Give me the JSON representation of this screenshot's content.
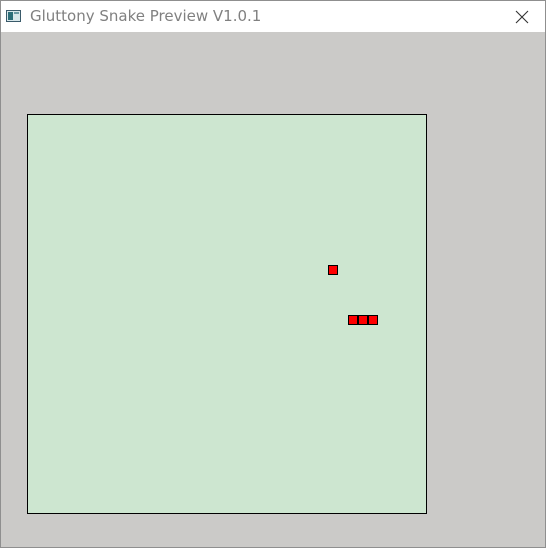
{
  "window": {
    "title": "Gluttony Snake Preview V1.0.1",
    "icon": "app-window-icon",
    "close_icon": "close-icon"
  },
  "colors": {
    "board_background": "#cde6d0",
    "board_border": "#000000",
    "snake": "#ff0000",
    "food": "#ff0000",
    "window_background": "#cbcac8"
  },
  "game": {
    "grid_columns": 40,
    "grid_rows": 40,
    "food": {
      "col": 30,
      "row": 15
    },
    "snake": [
      {
        "col": 32,
        "row": 20
      },
      {
        "col": 33,
        "row": 20
      },
      {
        "col": 34,
        "row": 20
      }
    ]
  }
}
